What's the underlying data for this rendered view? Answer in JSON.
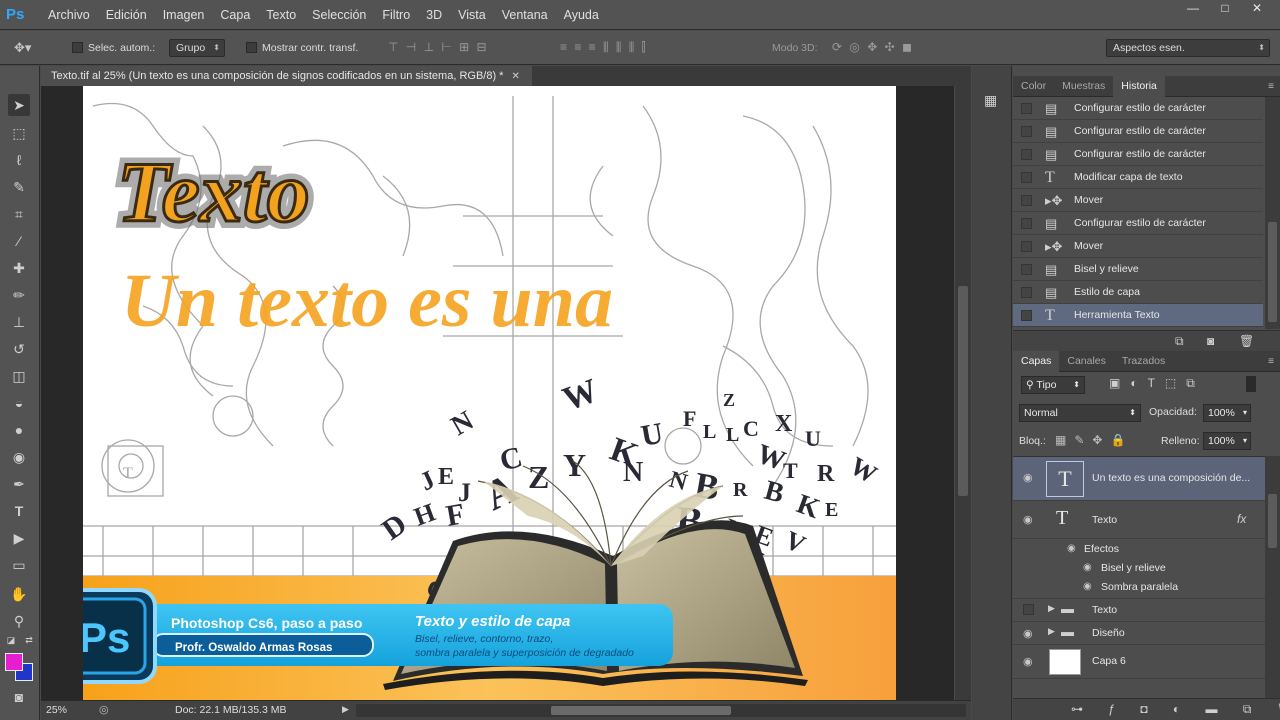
{
  "app": {
    "logo": "Ps"
  },
  "menu": [
    "Archivo",
    "Edición",
    "Imagen",
    "Capa",
    "Texto",
    "Selección",
    "Filtro",
    "3D",
    "Vista",
    "Ventana",
    "Ayuda"
  ],
  "window_controls": {
    "minimize": "—",
    "maximize": "□",
    "close": "✕"
  },
  "options": {
    "auto_select_label": "Selec. autom.:",
    "auto_select_target": "Grupo",
    "show_transform_label": "Mostrar contr. transf.",
    "mode_3d_label": "Modo 3D:",
    "workspace": "Aspectos esen."
  },
  "document": {
    "tab_title": "Texto.tif al 25% (Un texto es una composición de signos codificados en un sistema, RGB/8) *",
    "close": "✕"
  },
  "artwork": {
    "heading": "Texto",
    "subheading": "Un texto es una",
    "banner_course": "Photoshop Cs6, paso a paso",
    "banner_author": "Profr. Oswaldo Armas Rosas",
    "banner_title": "Texto y estilo de capa",
    "banner_subtitle_1": "Bisel, relieve, contorno, trazo,",
    "banner_subtitle_2": "sombra paralela y superposición de degradado",
    "badge": "Ps"
  },
  "status": {
    "zoom": "25%",
    "doc_info": "Doc: 22.1 MB/135.3 MB"
  },
  "history_panel": {
    "tabs": [
      "Color",
      "Muestras",
      "Historia"
    ],
    "active_tab": 2,
    "items": [
      {
        "label": "Configurar estilo de carácter",
        "icon": "page-icon"
      },
      {
        "label": "Configurar estilo de carácter",
        "icon": "page-icon"
      },
      {
        "label": "Configurar estilo de carácter",
        "icon": "page-icon"
      },
      {
        "label": "Modificar capa de texto",
        "icon": "type-icon"
      },
      {
        "label": "Mover",
        "icon": "move-icon"
      },
      {
        "label": "Configurar estilo de carácter",
        "icon": "page-icon"
      },
      {
        "label": "Mover",
        "icon": "move-icon"
      },
      {
        "label": "Bisel y relieve",
        "icon": "page-icon"
      },
      {
        "label": "Estilo de capa",
        "icon": "page-icon"
      },
      {
        "label": "Herramienta Texto",
        "icon": "type-icon"
      }
    ]
  },
  "layers_panel": {
    "tabs": [
      "Capas",
      "Canales",
      "Trazados"
    ],
    "active_tab": 0,
    "filter": "Tipo",
    "blend_mode": "Normal",
    "opacity_label": "Opacidad:",
    "opacity": "100%",
    "lock_label": "Bloq.:",
    "fill_label": "Relleno:",
    "fill": "100%",
    "layers": [
      {
        "name": "Un texto es una composición de...",
        "kind": "text"
      },
      {
        "name": "Texto",
        "kind": "text",
        "fx": "fx"
      },
      {
        "name": "Efectos",
        "kind": "effects"
      },
      {
        "name": "Bisel y relieve",
        "kind": "effect"
      },
      {
        "name": "Sombra paralela",
        "kind": "effect"
      },
      {
        "name": "Texto",
        "kind": "group"
      },
      {
        "name": "Diseño",
        "kind": "group"
      },
      {
        "name": "Capa 6",
        "kind": "pixel"
      }
    ]
  }
}
